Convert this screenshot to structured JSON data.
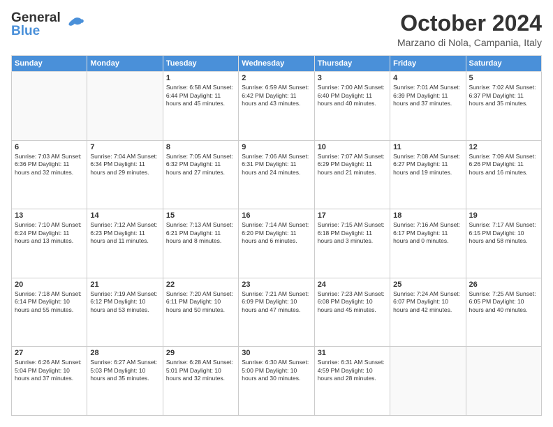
{
  "header": {
    "logo_line1": "General",
    "logo_line2": "Blue",
    "month_title": "October 2024",
    "location": "Marzano di Nola, Campania, Italy"
  },
  "days_of_week": [
    "Sunday",
    "Monday",
    "Tuesday",
    "Wednesday",
    "Thursday",
    "Friday",
    "Saturday"
  ],
  "weeks": [
    [
      {
        "day": "",
        "info": ""
      },
      {
        "day": "",
        "info": ""
      },
      {
        "day": "1",
        "info": "Sunrise: 6:58 AM\nSunset: 6:44 PM\nDaylight: 11 hours and 45 minutes."
      },
      {
        "day": "2",
        "info": "Sunrise: 6:59 AM\nSunset: 6:42 PM\nDaylight: 11 hours and 43 minutes."
      },
      {
        "day": "3",
        "info": "Sunrise: 7:00 AM\nSunset: 6:40 PM\nDaylight: 11 hours and 40 minutes."
      },
      {
        "day": "4",
        "info": "Sunrise: 7:01 AM\nSunset: 6:39 PM\nDaylight: 11 hours and 37 minutes."
      },
      {
        "day": "5",
        "info": "Sunrise: 7:02 AM\nSunset: 6:37 PM\nDaylight: 11 hours and 35 minutes."
      }
    ],
    [
      {
        "day": "6",
        "info": "Sunrise: 7:03 AM\nSunset: 6:36 PM\nDaylight: 11 hours and 32 minutes."
      },
      {
        "day": "7",
        "info": "Sunrise: 7:04 AM\nSunset: 6:34 PM\nDaylight: 11 hours and 29 minutes."
      },
      {
        "day": "8",
        "info": "Sunrise: 7:05 AM\nSunset: 6:32 PM\nDaylight: 11 hours and 27 minutes."
      },
      {
        "day": "9",
        "info": "Sunrise: 7:06 AM\nSunset: 6:31 PM\nDaylight: 11 hours and 24 minutes."
      },
      {
        "day": "10",
        "info": "Sunrise: 7:07 AM\nSunset: 6:29 PM\nDaylight: 11 hours and 21 minutes."
      },
      {
        "day": "11",
        "info": "Sunrise: 7:08 AM\nSunset: 6:27 PM\nDaylight: 11 hours and 19 minutes."
      },
      {
        "day": "12",
        "info": "Sunrise: 7:09 AM\nSunset: 6:26 PM\nDaylight: 11 hours and 16 minutes."
      }
    ],
    [
      {
        "day": "13",
        "info": "Sunrise: 7:10 AM\nSunset: 6:24 PM\nDaylight: 11 hours and 13 minutes."
      },
      {
        "day": "14",
        "info": "Sunrise: 7:12 AM\nSunset: 6:23 PM\nDaylight: 11 hours and 11 minutes."
      },
      {
        "day": "15",
        "info": "Sunrise: 7:13 AM\nSunset: 6:21 PM\nDaylight: 11 hours and 8 minutes."
      },
      {
        "day": "16",
        "info": "Sunrise: 7:14 AM\nSunset: 6:20 PM\nDaylight: 11 hours and 6 minutes."
      },
      {
        "day": "17",
        "info": "Sunrise: 7:15 AM\nSunset: 6:18 PM\nDaylight: 11 hours and 3 minutes."
      },
      {
        "day": "18",
        "info": "Sunrise: 7:16 AM\nSunset: 6:17 PM\nDaylight: 11 hours and 0 minutes."
      },
      {
        "day": "19",
        "info": "Sunrise: 7:17 AM\nSunset: 6:15 PM\nDaylight: 10 hours and 58 minutes."
      }
    ],
    [
      {
        "day": "20",
        "info": "Sunrise: 7:18 AM\nSunset: 6:14 PM\nDaylight: 10 hours and 55 minutes."
      },
      {
        "day": "21",
        "info": "Sunrise: 7:19 AM\nSunset: 6:12 PM\nDaylight: 10 hours and 53 minutes."
      },
      {
        "day": "22",
        "info": "Sunrise: 7:20 AM\nSunset: 6:11 PM\nDaylight: 10 hours and 50 minutes."
      },
      {
        "day": "23",
        "info": "Sunrise: 7:21 AM\nSunset: 6:09 PM\nDaylight: 10 hours and 47 minutes."
      },
      {
        "day": "24",
        "info": "Sunrise: 7:23 AM\nSunset: 6:08 PM\nDaylight: 10 hours and 45 minutes."
      },
      {
        "day": "25",
        "info": "Sunrise: 7:24 AM\nSunset: 6:07 PM\nDaylight: 10 hours and 42 minutes."
      },
      {
        "day": "26",
        "info": "Sunrise: 7:25 AM\nSunset: 6:05 PM\nDaylight: 10 hours and 40 minutes."
      }
    ],
    [
      {
        "day": "27",
        "info": "Sunrise: 6:26 AM\nSunset: 5:04 PM\nDaylight: 10 hours and 37 minutes."
      },
      {
        "day": "28",
        "info": "Sunrise: 6:27 AM\nSunset: 5:03 PM\nDaylight: 10 hours and 35 minutes."
      },
      {
        "day": "29",
        "info": "Sunrise: 6:28 AM\nSunset: 5:01 PM\nDaylight: 10 hours and 32 minutes."
      },
      {
        "day": "30",
        "info": "Sunrise: 6:30 AM\nSunset: 5:00 PM\nDaylight: 10 hours and 30 minutes."
      },
      {
        "day": "31",
        "info": "Sunrise: 6:31 AM\nSunset: 4:59 PM\nDaylight: 10 hours and 28 minutes."
      },
      {
        "day": "",
        "info": ""
      },
      {
        "day": "",
        "info": ""
      }
    ]
  ]
}
